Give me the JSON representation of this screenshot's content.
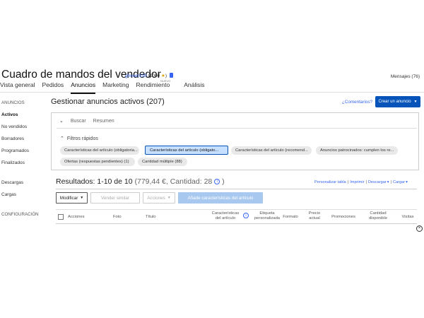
{
  "header": {
    "title": "Cuadro de mandos del vendedor",
    "username": "ghuser100",
    "feedback_score": "(1000",
    "feedback_close": ")",
    "messages": "Mensajes (76)"
  },
  "nav": {
    "tabs": [
      {
        "label": "Vista general"
      },
      {
        "label": "Pedidos"
      },
      {
        "label": "Anuncios",
        "active": true
      },
      {
        "label": "Marketing"
      },
      {
        "label": "Rendimiento"
      },
      {
        "label": "Análisis"
      }
    ],
    "new_badge": "NUEVO"
  },
  "sidebar": {
    "section_anuncios": "ANUNCIOS",
    "items": [
      {
        "label": "Activos"
      },
      {
        "label": "No vendidos"
      },
      {
        "label": "Borradores"
      },
      {
        "label": "Programados"
      },
      {
        "label": "Finalizados"
      },
      {
        "label": "Descargas"
      },
      {
        "label": "Cargas"
      }
    ],
    "section_config": "CONFIGURACIÓN"
  },
  "main": {
    "title": "Gestionar anuncios activos (207)",
    "feedback_link": "¿Comentarios?",
    "create_button": "Crear un anuncio",
    "tabs": [
      {
        "label": "Buscar"
      },
      {
        "label": "Resumen"
      }
    ],
    "quick_filters_label": "Filtros rápidos",
    "pills": [
      {
        "label": "Características del artículo (obligatoria..."
      },
      {
        "label": "Características del artículo (obligato...",
        "selected": true
      },
      {
        "label": "Características del artículo (recomend..."
      },
      {
        "label": "Anuncios patrocinados: cumplen los re..."
      },
      {
        "label": "Ofertas (respuestas pendientes) (1)"
      },
      {
        "label": "Cantidad múltiple (88)"
      }
    ],
    "results_main": "Resultados: 1-10 de 10",
    "results_sub": "(779,44 €, Cantidad: 28",
    "results_close": ")",
    "links": {
      "personalize": "Personalizar tabla",
      "print": "Imprimir",
      "download": "Descargar",
      "upload": "Cargar"
    },
    "buttons": {
      "modify": "Modificar",
      "sell_similar": "Vender similar",
      "actions": "Acciones",
      "add_features": "Añade características del artículo"
    },
    "table_headers": [
      "Acciones",
      "Foto",
      "Título",
      "Características del artículo",
      "Etiqueta personalizada",
      "Formato",
      "Precio actual",
      "Promociones",
      "Cantidad disponible",
      "Visitas"
    ]
  },
  "colors": {
    "primary": "#0654ba",
    "link": "#3665f3",
    "selected_pill": "#c8e0ff"
  }
}
